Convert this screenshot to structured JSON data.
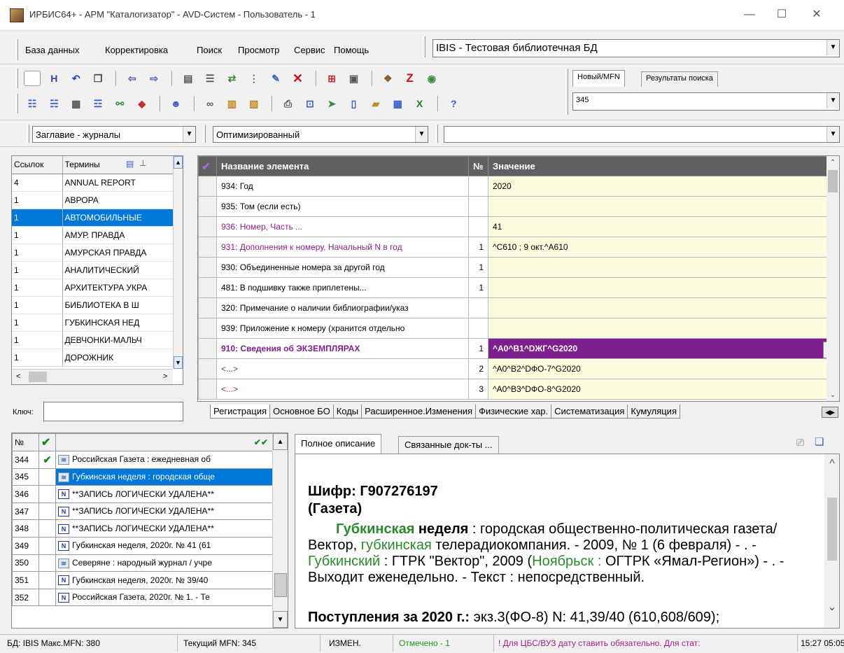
{
  "window": {
    "title": "ИРБИС64+ - АРМ \"Каталогизатор\" - AVD-Систем - Пользователь - 1",
    "minimize": "—",
    "maximize": "☐",
    "close": "✕"
  },
  "menu": {
    "items": [
      "База данных",
      "Корректировка",
      "Поиск",
      "Просмотр",
      "Сервис",
      "Помощь"
    ],
    "database": "IBIS - Тестовая библиотечная БД"
  },
  "search_tabs": {
    "tabs": [
      "Новый/MFN",
      "Результаты поиска"
    ],
    "mfn_value": "345"
  },
  "filters": {
    "dictionary": "Заглавие - журналы",
    "mode": "Оптимизированный",
    "extra": ""
  },
  "terms": {
    "headers": [
      "Ссылок",
      "Термины"
    ],
    "rows": [
      {
        "count": "4",
        "term": "ANNUAL REPORT"
      },
      {
        "count": "1",
        "term": "АВРОРА"
      },
      {
        "count": "1",
        "term": "АВТОМОБИЛЬНЫЕ"
      },
      {
        "count": "1",
        "term": "АМУР. ПРАВДА"
      },
      {
        "count": "1",
        "term": "АМУРСКАЯ ПРАВДА"
      },
      {
        "count": "1",
        "term": "АНАЛИТИЧЕСКИЙ"
      },
      {
        "count": "1",
        "term": "АРХИТЕКТУРА УКРА"
      },
      {
        "count": "1",
        "term": "БИБЛИОТЕКА В Ш"
      },
      {
        "count": "1",
        "term": "ГУБКИНСКАЯ НЕД"
      },
      {
        "count": "1",
        "term": "ДЕВЧОНКИ-МАЛЬЧ"
      },
      {
        "count": "1",
        "term": "ДОРОЖНИК"
      }
    ],
    "key_label": "Ключ:",
    "key_value": ""
  },
  "grid": {
    "headers": [
      "Название элемента",
      "№",
      "Значение"
    ],
    "rows": [
      {
        "name": "934: Год",
        "num": "",
        "value": "2020"
      },
      {
        "name": "935: Том (если есть)",
        "num": "",
        "value": ""
      },
      {
        "name": "936: Номер, Часть ...",
        "num": "",
        "value": "41"
      },
      {
        "name": "931: Дополнения к номеру, Начальный N в год",
        "num": "1",
        "value": "^C610 ; 9 окт.^A610"
      },
      {
        "name": "930: Объединенные номера за другой год",
        "num": "1",
        "value": ""
      },
      {
        "name": "481: В подшивку также приплетены...",
        "num": "1",
        "value": ""
      },
      {
        "name": "320: Примечание о наличии библиографии/указ",
        "num": "",
        "value": ""
      },
      {
        "name": "939: Приложение к номеру (хранится отдельно",
        "num": "",
        "value": ""
      },
      {
        "name": "910: Сведения  об ЭКЗЕМПЛЯРАХ",
        "num": "1",
        "value": "^A0^B1^DЖГ^G2020"
      },
      {
        "name": "<...>",
        "num": "2",
        "value": "^A0^B2^DФО-7^G2020"
      },
      {
        "name": "<...>",
        "num": "3",
        "value": "^A0^B3^DФО-8^G2020"
      }
    ],
    "ellipsis": "...",
    "tabs": [
      "Регистрация",
      "Основное БО",
      "Коды",
      "Расширенное.Изменения",
      "Физические хар.",
      "Систематизация",
      "Кумуляция"
    ]
  },
  "records": {
    "header_no": "№",
    "rows": [
      {
        "no": "344",
        "checked": true,
        "icon": "doc",
        "title": "Российская Газета : ежедневная об"
      },
      {
        "no": "345",
        "checked": false,
        "icon": "doc",
        "title": "Губкинская неделя : городская обще"
      },
      {
        "no": "346",
        "checked": false,
        "icon": "N",
        "title": "**ЗАПИСЬ ЛОГИЧЕСКИ УДАЛЕНА**"
      },
      {
        "no": "347",
        "checked": false,
        "icon": "N",
        "title": "**ЗАПИСЬ ЛОГИЧЕСКИ УДАЛЕНА**"
      },
      {
        "no": "348",
        "checked": false,
        "icon": "N",
        "title": "**ЗАПИСЬ ЛОГИЧЕСКИ УДАЛЕНА**"
      },
      {
        "no": "349",
        "checked": false,
        "icon": "N",
        "title": "Губкинская неделя, 2020г. № 41 (61"
      },
      {
        "no": "350",
        "checked": false,
        "icon": "doc",
        "title": "Северяне : народный журнал / учре"
      },
      {
        "no": "351",
        "checked": false,
        "icon": "N",
        "title": "Губкинская неделя, 2020г. № 39/40"
      },
      {
        "no": "352",
        "checked": false,
        "icon": "N",
        "title": "Российская Газета, 2020г. № 1. - Те"
      }
    ]
  },
  "description": {
    "tabs": [
      "Полное описание",
      "Связанные док-ты ..."
    ],
    "cipher": "Шифр: Г907276197",
    "type": "(Газета)",
    "title_a": "Губкинская",
    "title_b": " неделя",
    "text1": " : городская общественно-политическая газета/ Вектор, ",
    "g2": "губкинская",
    "text2": " телерадиокомпания. - 2009, № 1 (6 февраля) - . - ",
    "g3": "Губкинский",
    "text3": " : ГТРК \"Вектор\", 2009 (",
    "g4": "Ноябрьск",
    "g4b": " :",
    "text4": " ОГТРК «Ямал-Регион») - . - Выходит еженедельно. - Текст : непосредственный.",
    "receipt_label": "Поступления за 2020 г.:",
    "receipt_text": " экз.3(ФО-8) N: 41,39/40 (610,608/609);"
  },
  "status": {
    "db": "БД: IBIS Макс.MFN: 380",
    "current": "Текущий MFN: 345",
    "changed": "ИЗМЕН.",
    "marked": "Отмечено - 1",
    "hint": "! Для ЦБС/ВУЗ дату ставить обязательно. Для стат:",
    "time": "15:27 05:05"
  },
  "colors": {
    "selection": "#0078d7",
    "highlight": "#7e1f8e",
    "value_bg": "#fffde0",
    "link_green": "#2a8a2a"
  }
}
